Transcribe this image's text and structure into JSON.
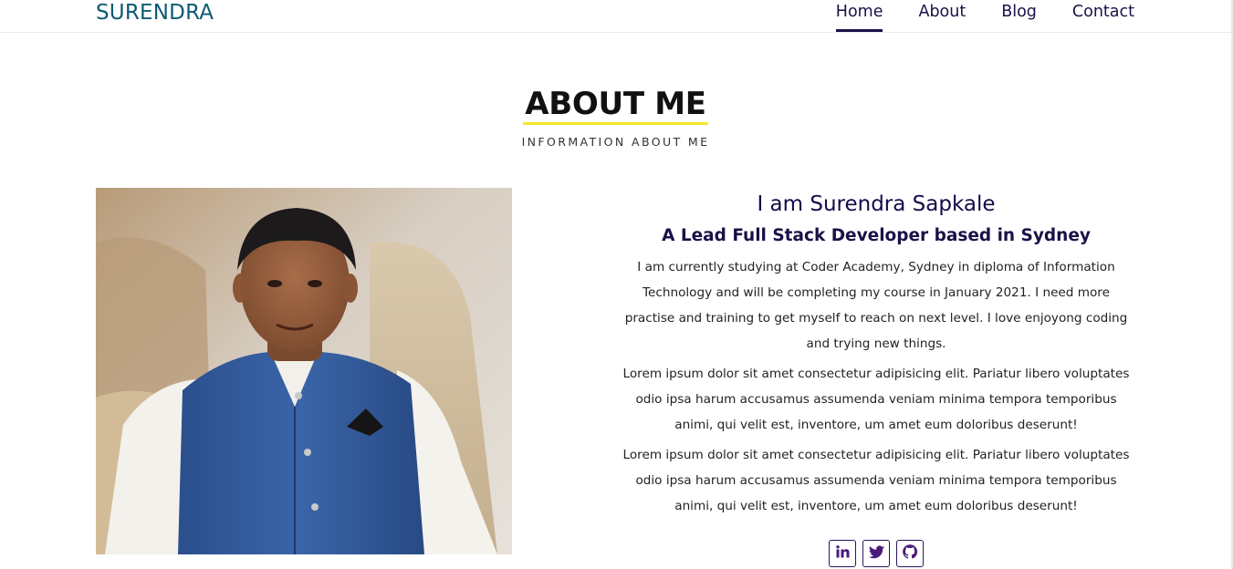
{
  "brand": "SURENDRA",
  "nav": {
    "items": [
      {
        "label": "Home",
        "active": true
      },
      {
        "label": "About",
        "active": false
      },
      {
        "label": "Blog",
        "active": false
      },
      {
        "label": "Contact",
        "active": false
      }
    ]
  },
  "section": {
    "title": "ABOUT ME",
    "subtitle": "INFORMATION ABOUT ME"
  },
  "about": {
    "name": "I am Surendra Sapkale",
    "role": "A Lead Full Stack Developer based in Sydney",
    "paragraphs": [
      "I am currently studying at Coder Academy, Sydney in diploma of Information Technology and will be completing my course in January 2021. I need more practise and training to get myself to reach on next level. I love enjoyong coding and trying new things.",
      "Lorem ipsum dolor sit amet consectetur adipisicing elit. Pariatur libero voluptates odio ipsa harum accusamus assumenda veniam minima tempora temporibus animi, qui velit est, inventore, um amet eum doloribus deserunt!",
      "Lorem ipsum dolor sit amet consectetur adipisicing elit. Pariatur libero voluptates odio ipsa harum accusamus assumenda veniam minima tempora temporibus animi, qui velit est, inventore, um amet eum doloribus deserunt!"
    ]
  },
  "socials": [
    {
      "name": "linkedin-icon",
      "glyph": "in"
    },
    {
      "name": "twitter-icon"
    },
    {
      "name": "github-icon"
    }
  ],
  "colors": {
    "brand": "#0f5a73",
    "nav_text": "#1a1147",
    "title_underline": "#f5e52a",
    "heading": "#120c4a",
    "social_border": "#2a1660"
  }
}
